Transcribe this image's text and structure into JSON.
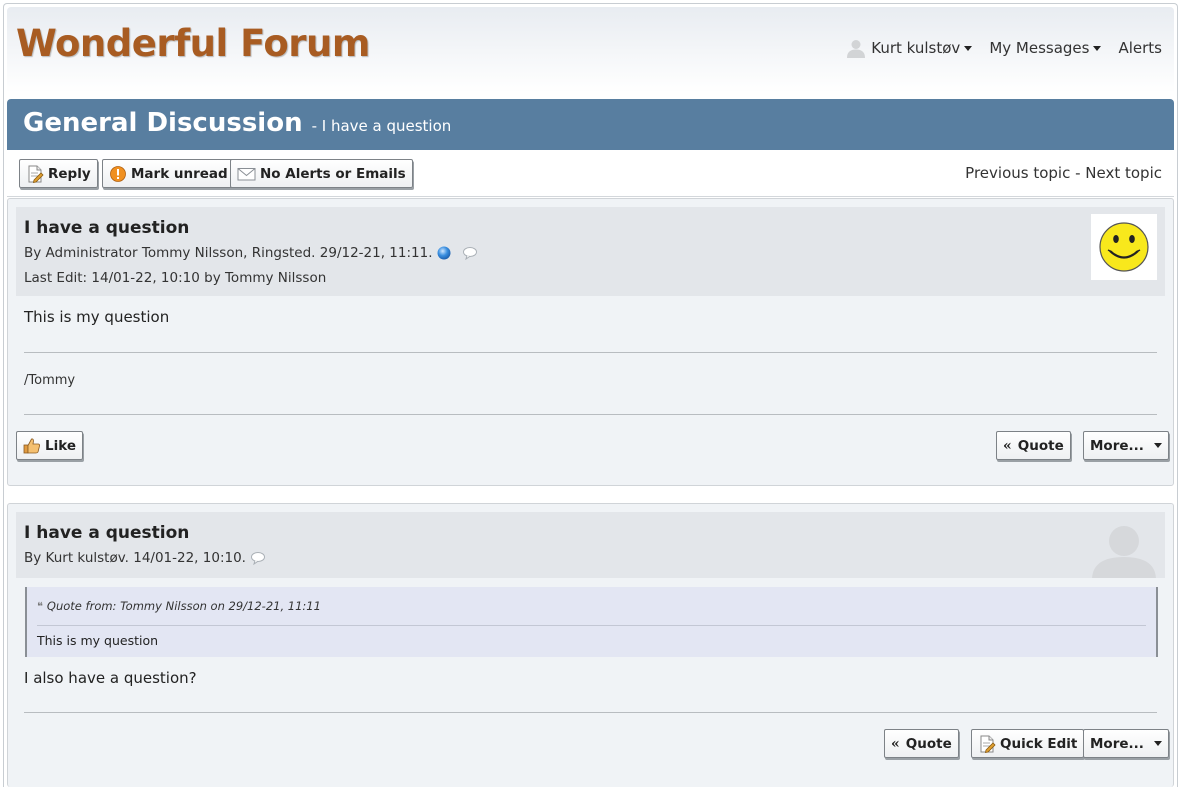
{
  "header": {
    "site_title": "Wonderful Forum",
    "user_menu": "Kurt kulstøv",
    "messages_menu": "My Messages",
    "alerts": "Alerts"
  },
  "forum": {
    "title": "General Discussion",
    "subtitle": "- I have a question"
  },
  "toolbar": {
    "reply": "Reply",
    "mark_unread": "Mark unread",
    "no_alerts": "No Alerts or Emails",
    "previous_topic": "Previous topic",
    "separator": " - ",
    "next_topic": "Next topic"
  },
  "posts": [
    {
      "title": "I have a question",
      "meta": "By Administrator Tommy Nilsson, Ringsted. 29/12-21, 11:11.",
      "last_edit": "Last Edit: 14/01-22, 10:10 by Tommy Nilsson",
      "body": "This is my question",
      "signature": "/Tommy",
      "like_label": "Like",
      "quote_label": "Quote",
      "more_label": "More..."
    },
    {
      "title": "I have a question",
      "meta": "By Kurt kulstøv. 14/01-22, 10:10.",
      "quote_header": "Quote from: Tommy Nilsson on 29/12-21, 11:11",
      "quote_text": "This is my question",
      "body": "I also have a question?",
      "quote_label": "Quote",
      "quick_edit_label": "Quick Edit",
      "more_label": "More..."
    }
  ],
  "colors": {
    "site_title": "#a85c22",
    "forum_bar": "#587ea0",
    "post_bg": "#f0f3f6",
    "post_head_bg": "#e3e6ea",
    "quote_bg": "#e3e6f3"
  }
}
